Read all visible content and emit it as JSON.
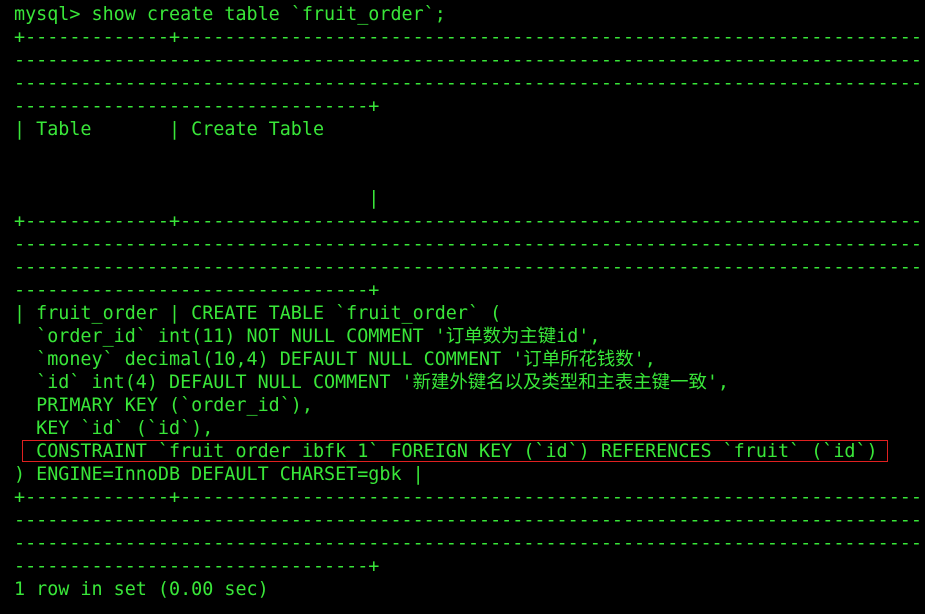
{
  "terminal": {
    "bg": "#000000",
    "fg": "#39e639",
    "highlight_color": "#e02020",
    "lines": [
      "mysql> show create table `fruit_order`;",
      "+-------------+----------------------------------------------------------------------------------------------------------------------------------------------------------------------------------------------------------------------------------------------------------------------------------------------------------------------------------------",
      "--------------------------------------------------------------------------------------------------------------------------------------------------------------------------------------------------------------------------------------------------------------------------------------------------------------------------------------------------------------------------------------",
      "--------------------------------------------------------------------------------------------------------------------------------------------------------------------------------------------------------------------------------------------------------------------------------------------------------------------------------------------------------------------------------------",
      "--------------------------------+",
      "| Table       | Create Table",
      "",
      "",
      "                                |",
      "+-------------+----------------------------------------------------------------------------------------------------------------------------------------------------------------------------------------------------------------------------------------------------------------------------------------------------------------------------------------",
      "--------------------------------------------------------------------------------------------------------------------------------------------------------------------------------------------------------------------------------------------------------------------------------------------------------------------------------------------------------------------------------------",
      "--------------------------------------------------------------------------------------------------------------------------------------------------------------------------------------------------------------------------------------------------------------------------------------------------------------------------------------------------------------------------------------",
      "--------------------------------+",
      "| fruit_order | CREATE TABLE `fruit_order` (",
      "  `order_id` int(11) NOT NULL COMMENT '订单数为主键id',",
      "  `money` decimal(10,4) DEFAULT NULL COMMENT '订单所花钱数',",
      "  `id` int(4) DEFAULT NULL COMMENT '新建外键名以及类型和主表主键一致',",
      "  PRIMARY KEY (`order_id`),",
      "  KEY `id` (`id`),",
      "  CONSTRAINT `fruit_order_ibfk_1` FOREIGN KEY (`id`) REFERENCES `fruit` (`id`)",
      ") ENGINE=InnoDB DEFAULT CHARSET=gbk |",
      "+-------------+----------------------------------------------------------------------------------------------------------------------------------------------------------------------------------------------------------------------------------------------------------------------------------------------------------------------------------------",
      "--------------------------------------------------------------------------------------------------------------------------------------------------------------------------------------------------------------------------------------------------------------------------------------------------------------------------------------------------------------------------------------",
      "--------------------------------------------------------------------------------------------------------------------------------------------------------------------------------------------------------------------------------------------------------------------------------------------------------------------------------------------------------------------------------------",
      "--------------------------------+",
      "1 row in set (0.00 sec)"
    ]
  }
}
